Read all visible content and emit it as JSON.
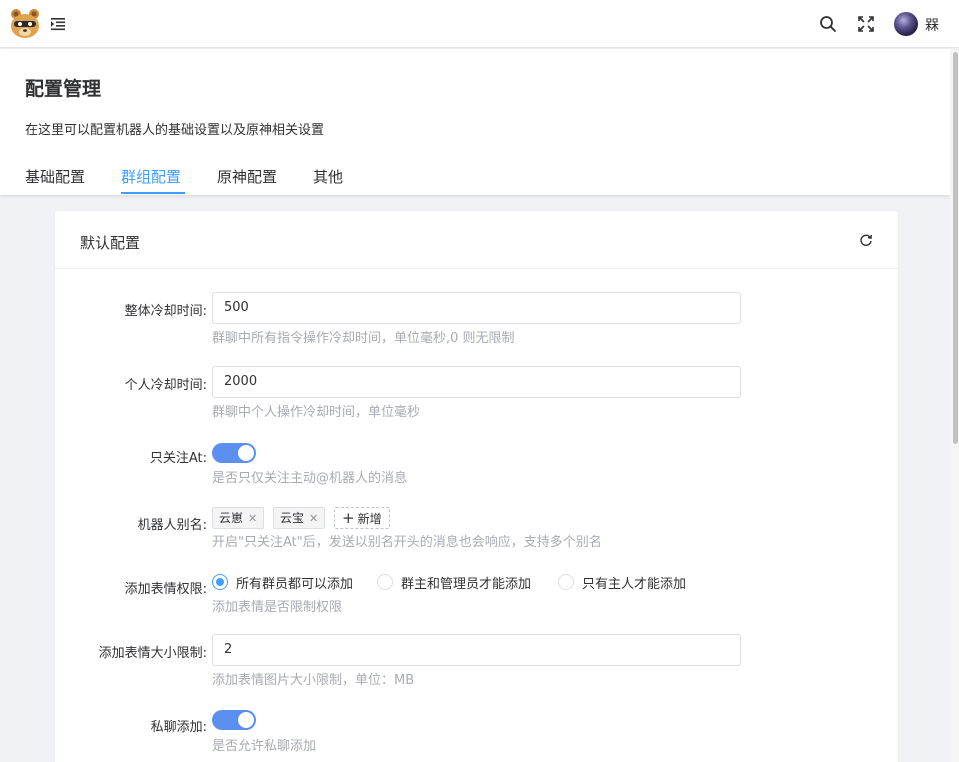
{
  "user": {
    "name": "槑"
  },
  "icons": {
    "logo": "bear-logo-icon",
    "menu": "menu-fold-icon",
    "search": "search-icon",
    "fullscreen": "fullscreen-icon",
    "refresh": "refresh-icon"
  },
  "colors": {
    "accent": "#409eff",
    "switch_on": "#5b8ff0"
  },
  "page": {
    "title": "配置管理",
    "description": "在这里可以配置机器人的基础设置以及原神相关设置",
    "tabs": [
      {
        "label": "基础配置",
        "active": false
      },
      {
        "label": "群组配置",
        "active": true
      },
      {
        "label": "原神配置",
        "active": false
      },
      {
        "label": "其他",
        "active": false
      }
    ]
  },
  "card": {
    "title": "默认配置",
    "fields": {
      "global_cooldown": {
        "label": "整体冷却时间:",
        "value": "500",
        "hint": "群聊中所有指令操作冷却时间，单位毫秒,0 则无限制"
      },
      "personal_cooldown": {
        "label": "个人冷却时间:",
        "value": "2000",
        "hint": "群聊中个人操作冷却时间，单位毫秒"
      },
      "only_at": {
        "label": "只关注At:",
        "on": true,
        "hint": "是否只仅关注主动@机器人的消息"
      },
      "bot_alias": {
        "label": "机器人别名:",
        "tags": [
          "云崽",
          "云宝"
        ],
        "add_label": "新增",
        "hint": "开启\"只关注At\"后，发送以别名开头的消息也会响应，支持多个别名"
      },
      "add_emoji_permission": {
        "label": "添加表情权限:",
        "options": [
          {
            "label": "所有群员都可以添加",
            "checked": true
          },
          {
            "label": "群主和管理员才能添加",
            "checked": false
          },
          {
            "label": "只有主人才能添加",
            "checked": false
          }
        ],
        "hint": "添加表情是否限制权限"
      },
      "emoji_size_limit": {
        "label": "添加表情大小限制:",
        "value": "2",
        "hint": "添加表情图片大小限制，单位：MB"
      },
      "private_add": {
        "label": "私聊添加:",
        "on": true,
        "hint": "是否允许私聊添加"
      }
    }
  }
}
